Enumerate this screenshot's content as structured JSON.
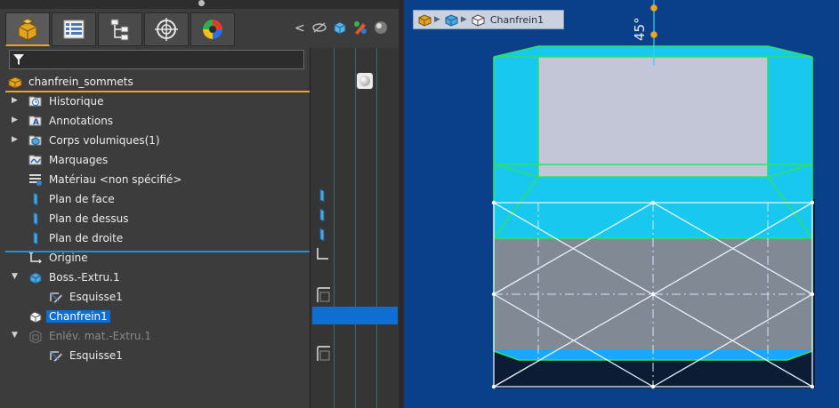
{
  "feature_manager": {
    "tabs": [
      {
        "name": "featuremanager-tab",
        "icon": "part-icon",
        "active": true
      },
      {
        "name": "propertymanager-tab",
        "icon": "property-list-icon",
        "active": false
      },
      {
        "name": "configurationmanager-tab",
        "icon": "configuration-tree-icon",
        "active": false
      },
      {
        "name": "dimxpert-tab",
        "icon": "target-crosshair-icon",
        "active": false
      },
      {
        "name": "display-manager-tab",
        "icon": "color-wheel-icon",
        "active": false
      }
    ],
    "root": {
      "label": "chanfrein_sommets",
      "icon": "part-icon"
    },
    "items": [
      {
        "label": "Historique",
        "icon": "history-icon",
        "expander": "collapsed"
      },
      {
        "label": "Annotations",
        "icon": "annotations-icon",
        "expander": "collapsed"
      },
      {
        "label": "Corps volumiques(1)",
        "icon": "solid-bodies-icon",
        "expander": "collapsed"
      },
      {
        "label": "Marquages",
        "icon": "markups-icon",
        "expander": "none"
      },
      {
        "label": "Matériau <non spécifié>",
        "icon": "material-icon",
        "expander": "none"
      },
      {
        "label": "Plan de face",
        "icon": "plane-icon",
        "expander": "none"
      },
      {
        "label": "Plan de dessus",
        "icon": "plane-icon",
        "expander": "none"
      },
      {
        "label": "Plan de droite",
        "icon": "plane-icon",
        "expander": "none"
      },
      {
        "label": "Origine",
        "icon": "origin-icon",
        "expander": "none"
      },
      {
        "label": "Boss.-Extru.1",
        "icon": "boss-extrude-icon",
        "expander": "expanded"
      },
      {
        "label": "Esquisse1",
        "icon": "sketch-icon",
        "expander": "none"
      },
      {
        "label": "Chanfrein1",
        "icon": "chamfer-icon",
        "expander": "none",
        "selected": true
      },
      {
        "label": "Enlév. mat.-Extru.1",
        "icon": "cut-extrude-icon",
        "expander": "expanded",
        "suppressed": true
      },
      {
        "label": "Esquisse1",
        "icon": "sketch-icon",
        "expander": "none"
      }
    ]
  },
  "viewport": {
    "breadcrumb": {
      "label": "Chanfrein1"
    },
    "dimension": {
      "text": "45°"
    }
  },
  "colors": {
    "panel_bg": "#3c3c3c",
    "accent_orange": "#e8a52a",
    "selection_blue": "#0d6fd1",
    "viewport_bg": "#0a3f8a",
    "chamfer_cyan": "#19c8ee",
    "edge_green": "#2de06b"
  }
}
